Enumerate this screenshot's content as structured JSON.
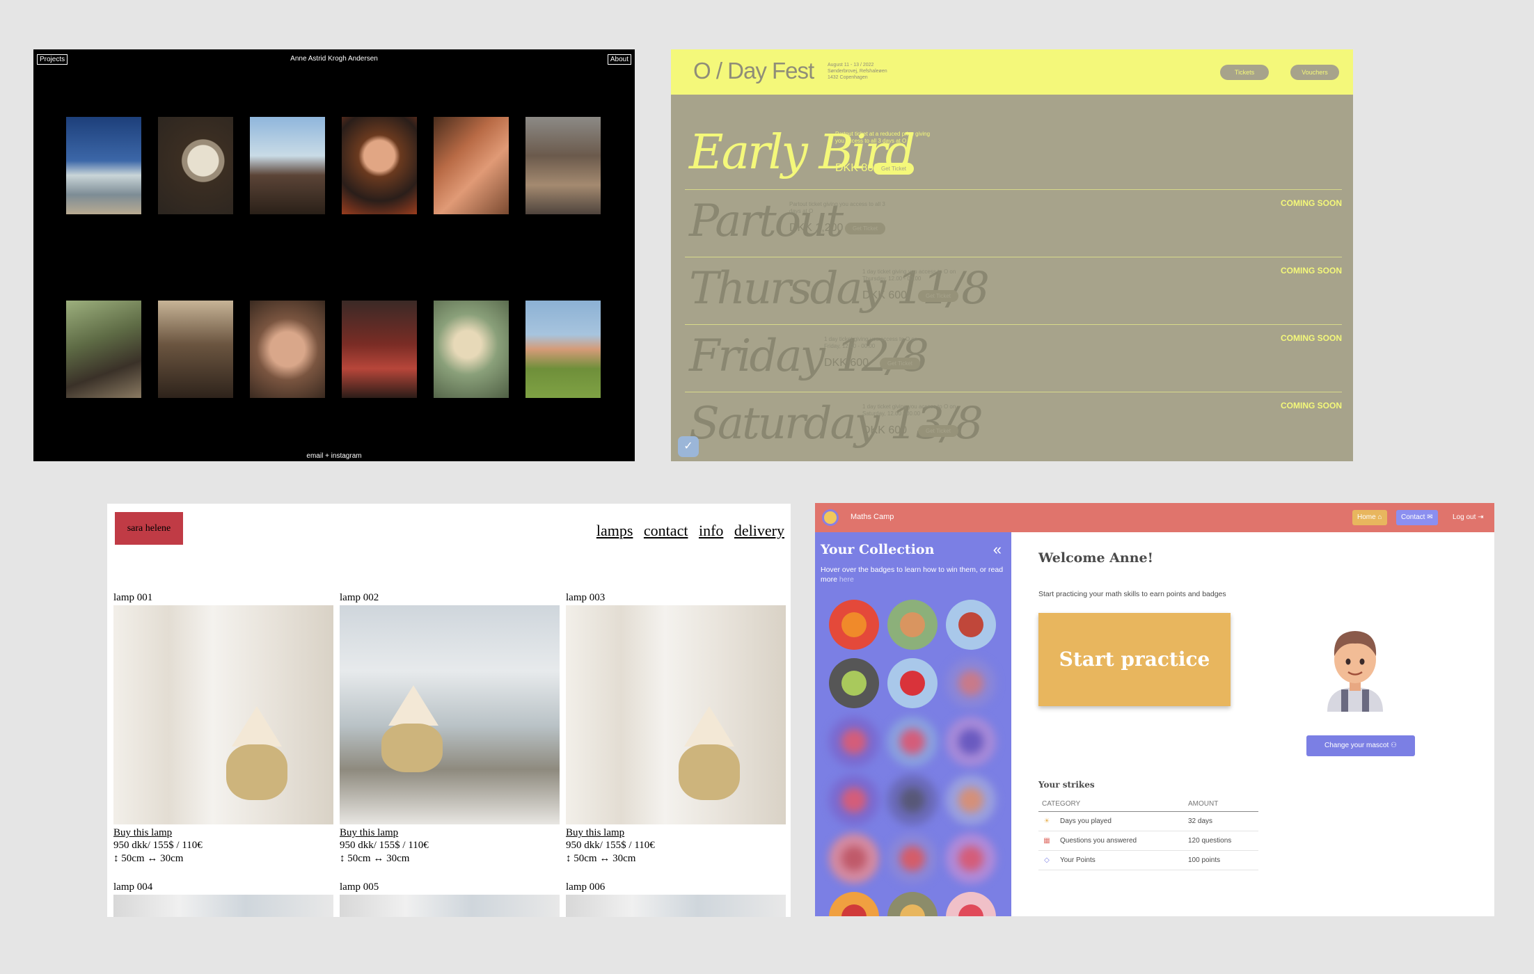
{
  "portfolio": {
    "nav_left": "Projects",
    "title": "Anne Astrid Krogh Andersen",
    "nav_right": "About",
    "footer": "email + instagram",
    "photos": [
      {
        "subject": "woman on beach",
        "bg": "linear-gradient(180deg,#1d3f7a 0%,#3c67a8 45%,#c9d5d8 60%,#7d8c95 80%,#b9ab92 100%)"
      },
      {
        "subject": "man with mirror",
        "bg": "radial-gradient(circle at 60% 45%,#e7e0cf 0 22%,#9a8c78 23% 30%,#3b2e22 31%,#2b2520 100%)"
      },
      {
        "subject": "man sky portrait",
        "bg": "linear-gradient(180deg,#8fb6dc 0%,#c9dbe6 40%,#5b4437 60%,#2a2018 100%)"
      },
      {
        "subject": "woman portrait",
        "bg": "radial-gradient(circle at 50% 40%,#e1a684 0 22%,#6b3a1f 30%,#2a1e1a 65%,#9b3d1e 100%)"
      },
      {
        "subject": "close face",
        "bg": "linear-gradient(135deg,#4a2d1d 0%,#b86a45 35%,#e09a76 60%,#7a4a31 100%)"
      },
      {
        "subject": "woman fur coat",
        "bg": "linear-gradient(180deg,#8c8a86 0%,#6b5a4c 40%,#a48a70 70%,#4f443d 100%)"
      },
      {
        "subject": "woman with dog",
        "bg": "linear-gradient(160deg,#9db07e 0%,#5e6b45 40%,#3a3128 70%,#8a7a62 100%)"
      },
      {
        "subject": "man on bed",
        "bg": "linear-gradient(180deg,#c7b497 0%,#6b5540 45%,#2e231b 100%)"
      },
      {
        "subject": "woman lying",
        "bg": "radial-gradient(circle at 50% 50%,#d9a78a 0 28%,#7a5540 50%,#3a2a20 100%)"
      },
      {
        "subject": "man red room",
        "bg": "linear-gradient(180deg,#3a2a26 0%,#7a2c25 45%,#b7463a 70%,#2c1d18 100%)"
      },
      {
        "subject": "blurred face",
        "bg": "radial-gradient(circle at 45% 45%,#e7d9b8 0 20%,#8aa07a 45%,#4f5f44 100%)"
      },
      {
        "subject": "woman green sweater",
        "bg": "linear-gradient(180deg,#8cb1d4 0%,#a7c4de 35%,#d59b78 50%,#6f8f3a 70%,#7fa244 100%)"
      }
    ]
  },
  "festival": {
    "logo": "O / Day Fest",
    "meta": [
      "August 11 - 13 / 2022",
      "Sønderbrovej, Refshaleøen",
      "1432 Copenhagen"
    ],
    "nav": [
      "Tickets",
      "Vouchers"
    ],
    "get_ticket": "Get Ticket",
    "coming_soon": "COMING SOON",
    "tickets": [
      {
        "name": "Early Bird",
        "desc": "Partout ticket at a reduced price giving you access to all 3 days at O",
        "price": "DKK 800",
        "active": true
      },
      {
        "name": "Partout",
        "desc": "Partout ticket giving you access to all 3 days at O",
        "price": "DKK 1,200",
        "active": false
      },
      {
        "name": "Thursday 11/8",
        "desc": "1 day ticket giving you access to O on Thursday, 12.00 - 00.00",
        "price": "DKK 600",
        "active": false
      },
      {
        "name": "Friday 12/8",
        "desc": "1 day ticket giving you access to O on Friday, 12.00 - 00.00",
        "price": "DKK 600",
        "active": false
      },
      {
        "name": "Saturday 13/8",
        "desc": "1 day ticket giving you access to O on Saturday, 12.00 - 00.00",
        "price": "DKK 600",
        "active": false
      }
    ]
  },
  "shop": {
    "brand": "sara helene",
    "nav": [
      "lamps",
      "contact",
      "info",
      "delivery"
    ],
    "lamps": [
      {
        "title": "lamp 001",
        "buy": "Buy this lamp",
        "price": "950 dkk/ 155$ / 110€",
        "size": "↕ 50cm ↔ 30cm"
      },
      {
        "title": "lamp 002",
        "buy": "Buy this lamp",
        "price": "950 dkk/ 155$ / 110€",
        "size": "↕ 50cm ↔ 30cm"
      },
      {
        "title": "lamp 003",
        "buy": "Buy this lamp",
        "price": "950 dkk/ 155$ / 110€",
        "size": "↕ 50cm ↔ 30cm"
      },
      {
        "title": "lamp 004"
      },
      {
        "title": "lamp 005"
      },
      {
        "title": "lamp 006"
      }
    ]
  },
  "maths": {
    "app_title": "Maths Camp",
    "nav": {
      "home": "Home",
      "contact": "Contact",
      "logout": "Log out"
    },
    "colors": {
      "header": "#e0746c",
      "sidebar": "#7b7fe4",
      "start": "#e8b65e",
      "home_btn": "#e8b65e",
      "contact_btn": "#8b8ff0"
    },
    "collection_title": "Your Collection",
    "collection_sub_prefix": "Hover over the badges to learn how to win them, or read more ",
    "collection_sub_link": "here",
    "welcome": "Welcome Anne!",
    "lead": "Start practicing your math skills to earn points and badges",
    "start": "Start practice",
    "change_mascot": "Change your mascot",
    "strikes_title": "Your strikes",
    "table": {
      "headers": [
        "CATEGORY",
        "AMOUNT"
      ],
      "rows": [
        {
          "icon": "sun-icon",
          "glyph": "☀",
          "color": "#e8b65e",
          "category": "Days you played",
          "amount": "32 days"
        },
        {
          "icon": "calendar-icon",
          "glyph": "▦",
          "color": "#e0746c",
          "category": "Questions you answered",
          "amount": "120 questions"
        },
        {
          "icon": "diamond-icon",
          "glyph": "◇",
          "color": "#7b7fe4",
          "category": "Your Points",
          "amount": "100 points"
        }
      ]
    },
    "badges": [
      {
        "name": "orange-badge",
        "bg": "#e4493a",
        "inner": "#f08a2a",
        "locked": false
      },
      {
        "name": "croissant-badge",
        "bg": "#8cb07a",
        "inner": "#d99560",
        "locked": false
      },
      {
        "name": "cake-badge",
        "bg": "#a9c8ea",
        "inner": "#c0473a",
        "locked": false
      },
      {
        "name": "avocado-badge",
        "bg": "#565656",
        "inner": "#a9c95c",
        "locked": false
      },
      {
        "name": "strawberry-badge",
        "bg": "#a9c8ea",
        "inner": "#d9333a",
        "locked": false
      },
      {
        "name": "locked-badge",
        "bg": "#8a86d8",
        "inner": "#c87a8a",
        "locked": true
      },
      {
        "name": "locked-badge",
        "bg": "#7a6ad0",
        "inner": "#d45d7a",
        "locked": true
      },
      {
        "name": "locked-badge",
        "bg": "#8aa0de",
        "inner": "#d45d7a",
        "locked": true
      },
      {
        "name": "locked-badge",
        "bg": "#a68ad8",
        "inner": "#6a5ac0",
        "locked": true
      },
      {
        "name": "locked-badge",
        "bg": "#7a6ad0",
        "inner": "#d45d7a",
        "locked": true
      },
      {
        "name": "locked-badge",
        "bg": "#6a6ab8",
        "inner": "#585878",
        "locked": true
      },
      {
        "name": "locked-badge",
        "bg": "#9aa0de",
        "inner": "#d4907a",
        "locked": true
      },
      {
        "name": "locked-badge",
        "bg": "#d48aa0",
        "inner": "#c05a6a",
        "locked": true
      },
      {
        "name": "locked-badge",
        "bg": "#8a86d8",
        "inner": "#d45d6a",
        "locked": true
      },
      {
        "name": "locked-badge",
        "bg": "#b08ad8",
        "inner": "#d45d7a",
        "locked": true
      },
      {
        "name": "love-lips-badge",
        "bg": "#f0a040",
        "inner": "#d03a3a",
        "locked": false
      },
      {
        "name": "backpack-badge",
        "bg": "#8c8c6a",
        "inner": "#e8b65e",
        "locked": false
      },
      {
        "name": "heart-badge",
        "bg": "#f0c0c8",
        "inner": "#e04a5a",
        "locked": false
      }
    ]
  }
}
